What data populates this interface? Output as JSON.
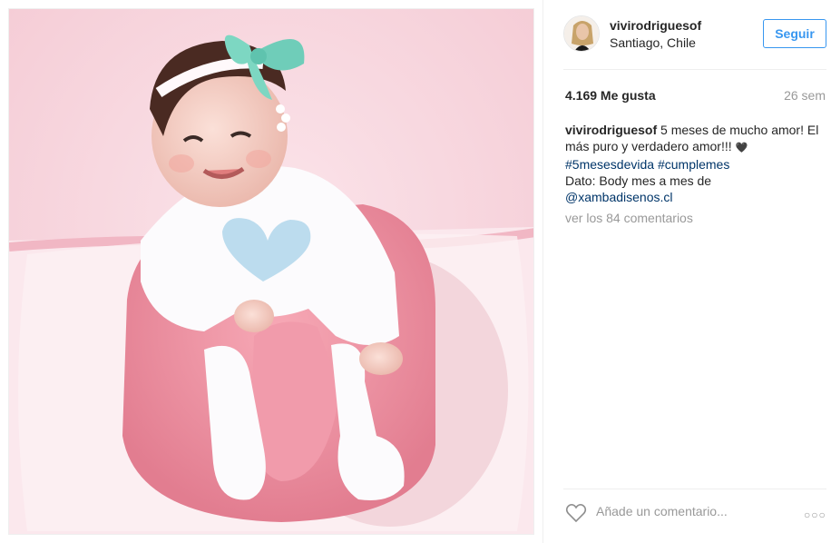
{
  "post": {
    "username": "vivirodriguesof",
    "location": "Santiago, Chile",
    "follow_label": "Seguir",
    "likes": "4.169 Me gusta",
    "time": "26 sem",
    "caption": {
      "user": "vivirodriguesof",
      "line1": " 5 meses de mucho amor! El más puro y verdadero amor!!! ",
      "heart": "🖤",
      "tag1": "#5mesesdevida",
      "tag2": "#cumplemes",
      "dato": "Dato: Body mes a mes de",
      "mention": "@xambadisenos.cl"
    },
    "comments_link": "ver los 84 comentarios",
    "comment_placeholder": "Añade un comentario...",
    "more_label": "○○○"
  },
  "icons": {
    "like": "heart-outline-icon",
    "more": "more-options-icon"
  },
  "colors": {
    "link_blue": "#3897f0",
    "tag_blue": "#003569",
    "muted": "#999999",
    "text": "#262626"
  }
}
